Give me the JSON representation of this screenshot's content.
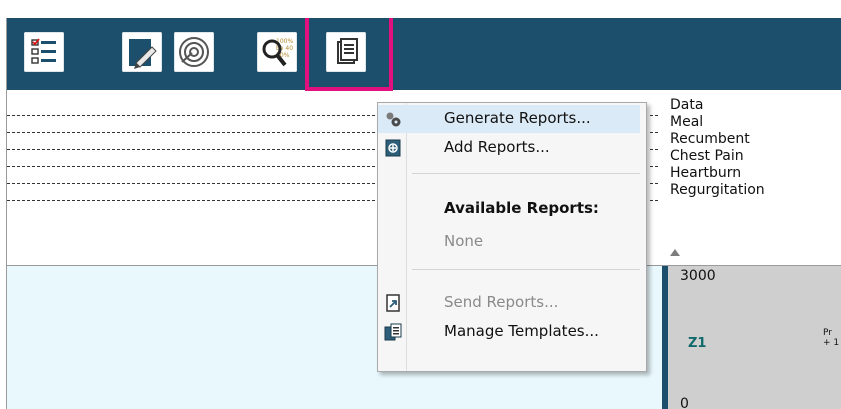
{
  "toolbar": {
    "buttons": [
      {
        "icon": "checklist-icon"
      },
      {
        "icon": "edit-document-icon"
      },
      {
        "icon": "target-icon"
      },
      {
        "icon": "analysis-search-icon",
        "badge_text": "100%\nbe 40\n70%"
      },
      {
        "icon": "reports-icon"
      }
    ]
  },
  "context_menu": {
    "items": [
      {
        "label": "Generate Reports...",
        "icon": "gear-report-icon",
        "highlighted": true
      },
      {
        "label": "Add Reports...",
        "icon": "add-report-icon"
      },
      {
        "label": "Available Reports:",
        "header": true
      },
      {
        "label": "None",
        "disabled": true
      },
      {
        "label": "Send Reports...",
        "icon": "send-report-icon",
        "disabled": true
      },
      {
        "label": "Manage Templates...",
        "icon": "templates-icon"
      }
    ]
  },
  "event_labels": [
    "Data",
    "Meal",
    "Recumbent",
    "Chest Pain",
    "Heartburn",
    "Regurgitation"
  ],
  "graph": {
    "y_top": "3000",
    "y_bottom": "0",
    "channel": "Z1",
    "partial_label": "Pr\n+ 1"
  },
  "colors": {
    "toolbar": "#1c4f6c",
    "highlight_box": "#e0117f",
    "lower_panel": "#e8f8fd",
    "menu_highlight": "#dbeaf7",
    "channel_text": "#0f6a6b"
  }
}
